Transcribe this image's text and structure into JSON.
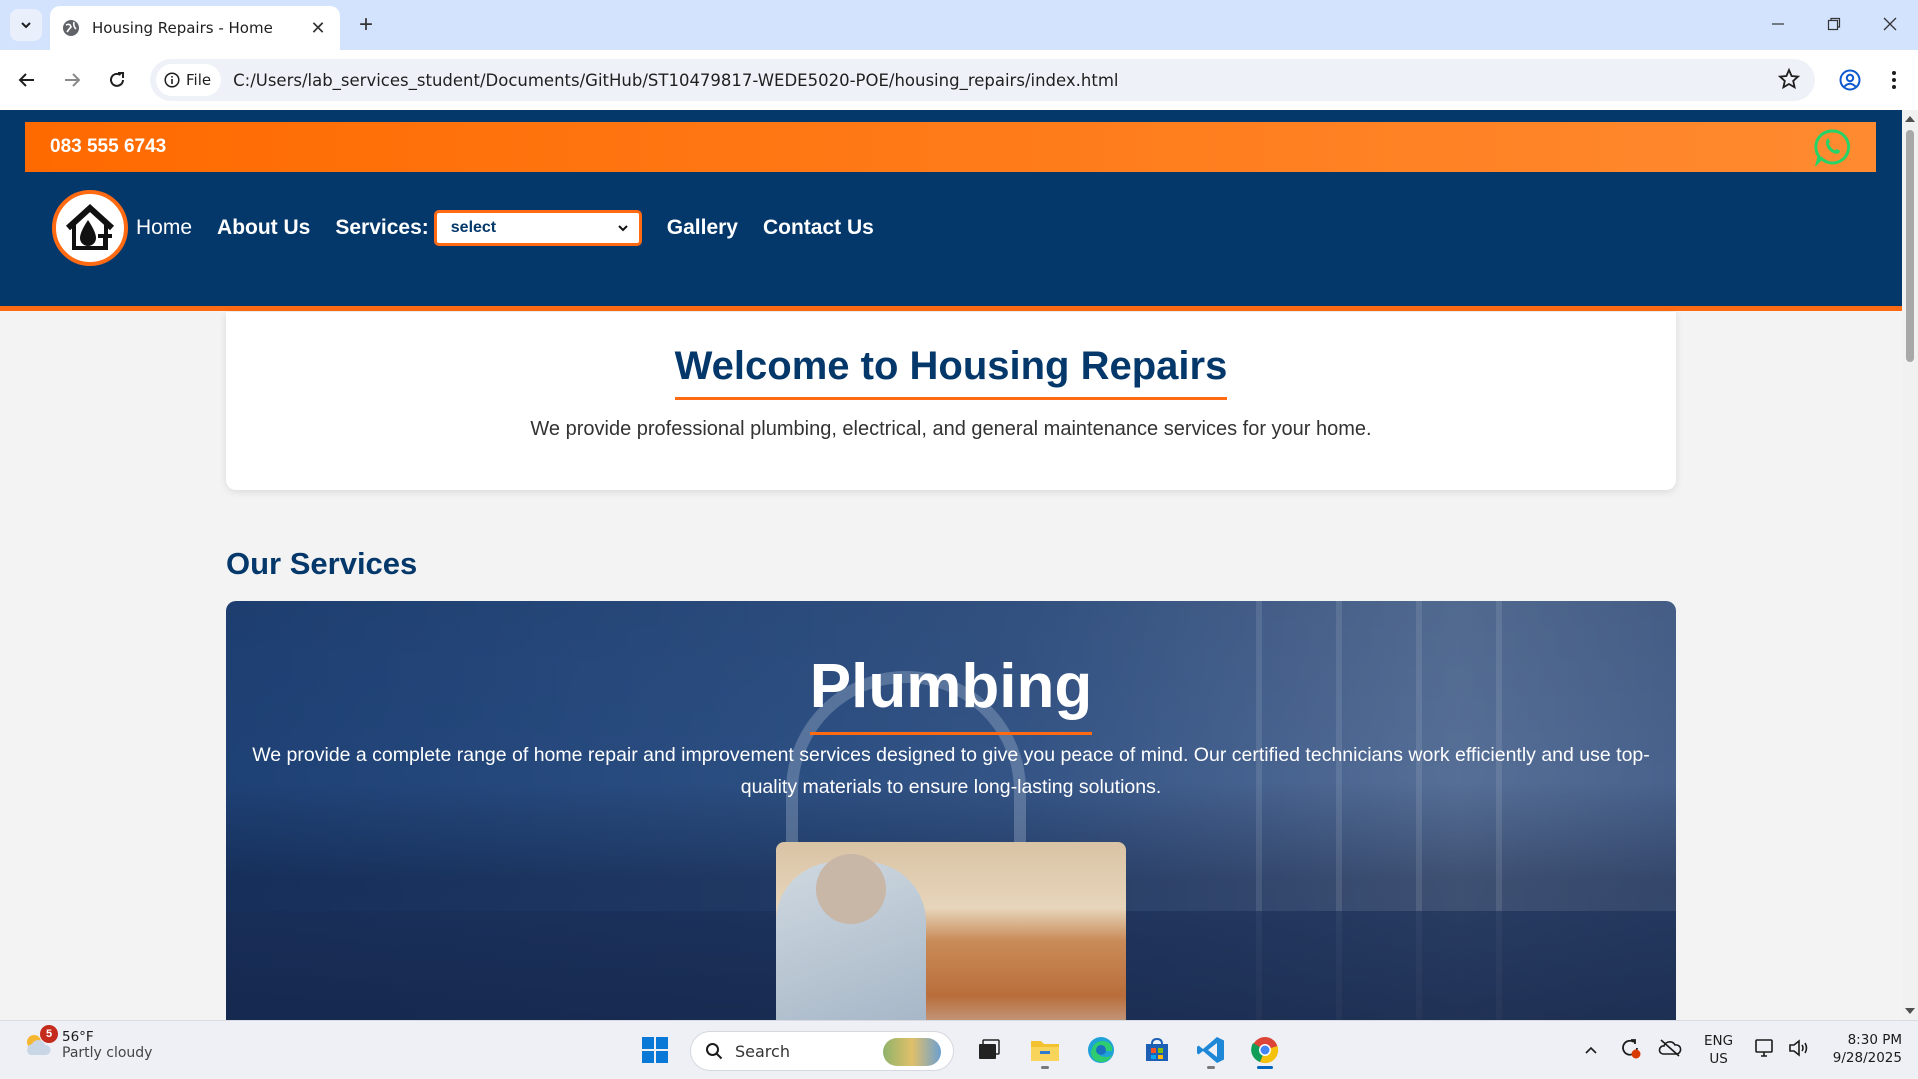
{
  "browser": {
    "tab_title": "Housing Repairs - Home",
    "url": "C:/Users/lab_services_student/Documents/GitHub/ST10479817-WEDE5020-POE/housing_repairs/index.html",
    "site_info_chip": "File"
  },
  "site": {
    "phone": "083 555 6743",
    "nav": {
      "home": "Home",
      "about": "About Us",
      "services_label": "Services:",
      "services_select_value": "select",
      "gallery": "Gallery",
      "contact": "Contact Us"
    },
    "welcome": {
      "heading": "Welcome to Housing Repairs",
      "text": "We provide professional plumbing, electrical, and general maintenance services for your home."
    },
    "services_section_title": "Our Services",
    "service_card": {
      "title": "Plumbing",
      "description": "We provide a complete range of home repair and improvement services designed to give you peace of mind. Our certified technicians work efficiently and use top-quality materials to ensure long-lasting solutions."
    },
    "colors": {
      "navy": "#04376a",
      "orange": "#ff6a13",
      "whatsapp": "#25d366"
    }
  },
  "taskbar": {
    "weather_temp": "56°F",
    "weather_condition": "Partly cloudy",
    "weather_badge": "5",
    "search_placeholder": "Search",
    "language_line1": "ENG",
    "language_line2": "US",
    "time": "8:30 PM",
    "date": "9/28/2025"
  }
}
